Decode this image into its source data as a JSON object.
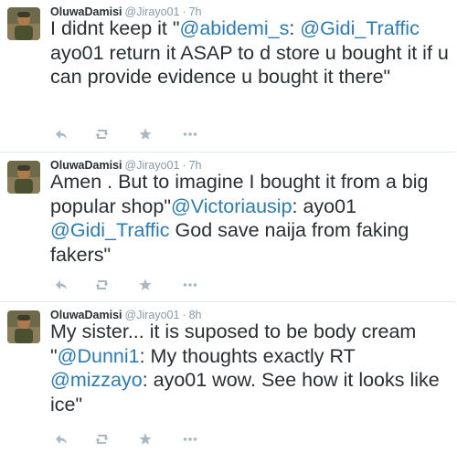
{
  "tweets": [
    {
      "name": "OluwaDamisi",
      "handle": "@Jirayo01",
      "separator": "·",
      "time": "7h",
      "text": [
        {
          "t": "I didnt keep it \"",
          "m": false
        },
        {
          "t": "@abidemi_s",
          "m": true
        },
        {
          "t": ": ",
          "m": false
        },
        {
          "t": "@Gidi_Traffic",
          "m": true
        },
        {
          "t": " ayo01 return it ASAP to d store u bought it if u can provide evidence u bought it there\"",
          "m": false
        }
      ]
    },
    {
      "name": "OluwaDamisi",
      "handle": "@Jirayo01",
      "separator": "·",
      "time": "7h",
      "text": [
        {
          "t": "Amen . But to imagine I bought it from a big popular shop\"",
          "m": false
        },
        {
          "t": "@Victoriausip",
          "m": true
        },
        {
          "t": ": ayo01 ",
          "m": false
        },
        {
          "t": "@Gidi_Traffic",
          "m": true
        },
        {
          "t": " God save naija from faking fakers\"",
          "m": false
        }
      ]
    },
    {
      "name": "OluwaDamisi",
      "handle": "@Jirayo01",
      "separator": "·",
      "time": "8h",
      "text": [
        {
          "t": "My sister... it is suposed to be body cream \"",
          "m": false
        },
        {
          "t": "@Dunni1",
          "m": true
        },
        {
          "t": ": My thoughts exactly RT ",
          "m": false
        },
        {
          "t": "@mizzayo",
          "m": true
        },
        {
          "t": ": ayo01 wow. See how it looks like ice\"",
          "m": false
        }
      ]
    }
  ],
  "action_icons": [
    "reply-icon",
    "retweet-icon",
    "favorite-icon",
    "more-icon"
  ]
}
